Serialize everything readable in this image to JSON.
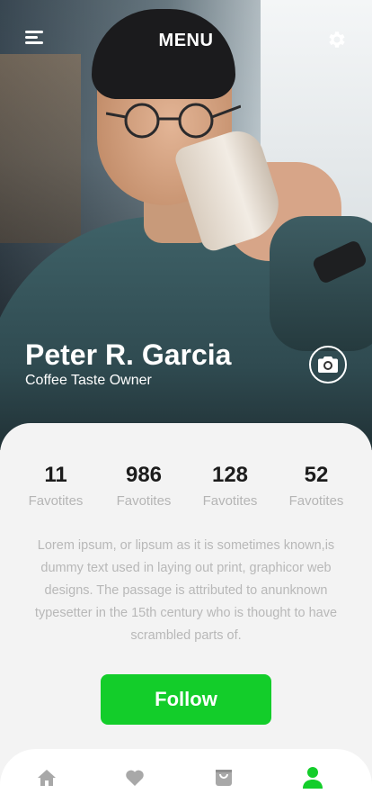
{
  "header": {
    "title": "MENU",
    "menu_icon": "hamburger-menu-icon",
    "settings_icon": "gear-icon"
  },
  "profile": {
    "name": "Peter R. Garcia",
    "role": "Coffee Taste Owner",
    "camera_icon": "camera-icon"
  },
  "stats": [
    {
      "value": "11",
      "label": "Favotites"
    },
    {
      "value": "986",
      "label": "Favotites"
    },
    {
      "value": "128",
      "label": "Favotites"
    },
    {
      "value": "52",
      "label": "Favotites"
    }
  ],
  "bio": "Lorem ipsum, or lipsum as it is sometimes known,is dummy text used in laying out print, graphicor web designs. The passage is attributed to anunknown typesetter in the 15th century who is thought to have scrambled parts of.",
  "follow_label": "Follow",
  "tabbar": {
    "items": [
      {
        "icon": "home-icon",
        "active": false
      },
      {
        "icon": "heart-icon",
        "active": false
      },
      {
        "icon": "shopping-bag-icon",
        "active": false
      },
      {
        "icon": "user-icon",
        "active": true
      }
    ]
  },
  "colors": {
    "accent": "#13cd2a",
    "inactive_icon": "#a8a8a8",
    "text_dark": "#1c1c1c",
    "text_muted": "#b8b8b8"
  }
}
